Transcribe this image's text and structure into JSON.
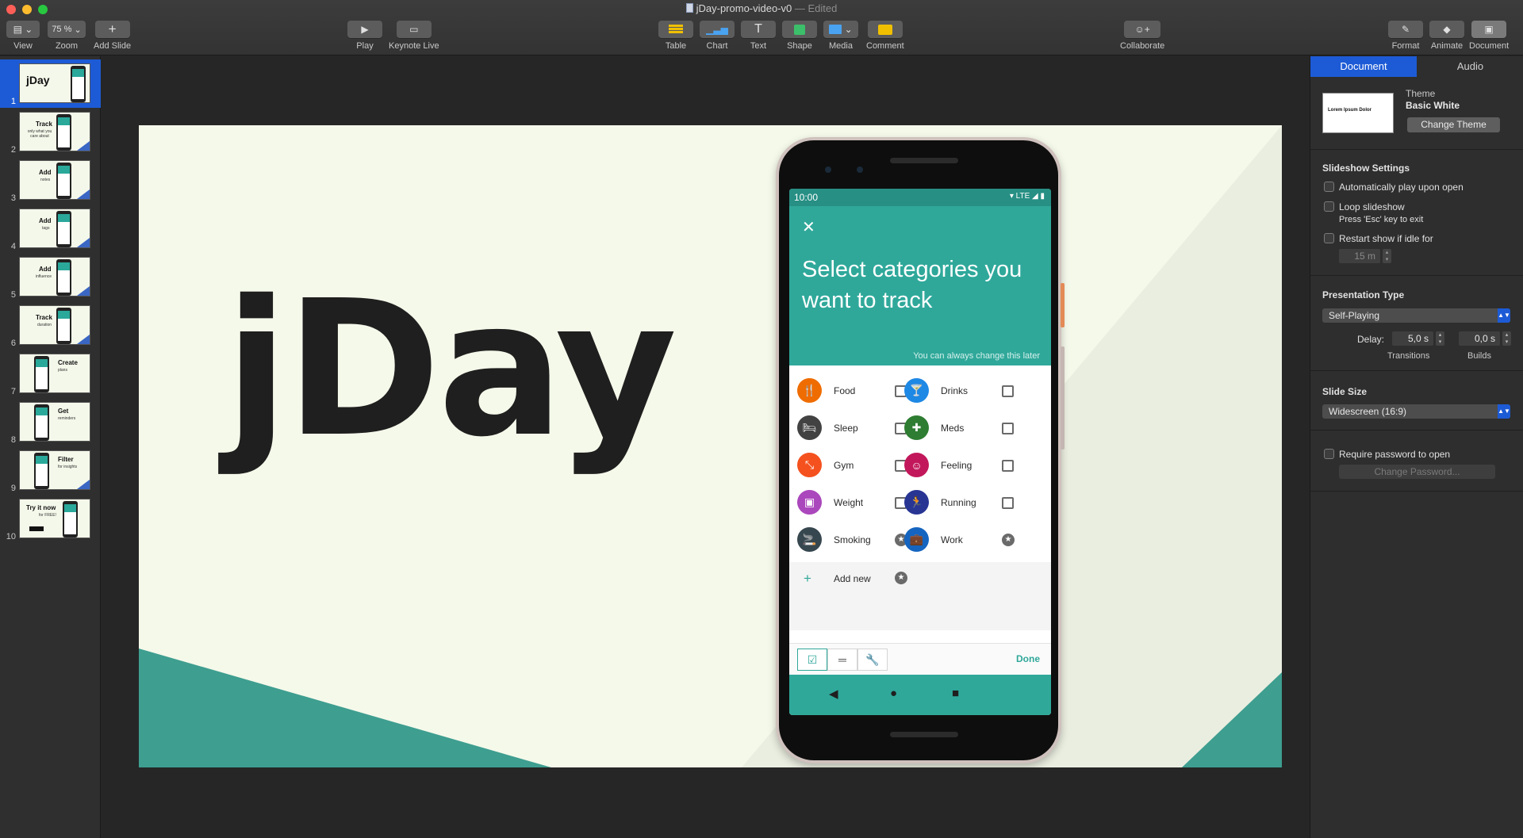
{
  "window": {
    "title": "jDay-promo-video-v0",
    "status": "— Edited"
  },
  "toolbar": {
    "view": "View",
    "zoom": "Zoom",
    "zoom_value": "75 %",
    "add_slide": "Add Slide",
    "play": "Play",
    "keynote_live": "Keynote Live",
    "table": "Table",
    "chart": "Chart",
    "text": "Text",
    "shape": "Shape",
    "media": "Media",
    "comment": "Comment",
    "collaborate": "Collaborate",
    "format": "Format",
    "animate": "Animate",
    "document": "Document"
  },
  "navigator": {
    "slides": [
      {
        "num": "1",
        "title": "jDay",
        "sub": ""
      },
      {
        "num": "2",
        "title": "Track",
        "sub": "only what you care about"
      },
      {
        "num": "3",
        "title": "Add",
        "sub": "notes"
      },
      {
        "num": "4",
        "title": "Add",
        "sub": "tags"
      },
      {
        "num": "5",
        "title": "Add",
        "sub": "influence"
      },
      {
        "num": "6",
        "title": "Track",
        "sub": "duration"
      },
      {
        "num": "7",
        "title": "Create",
        "sub": "plans"
      },
      {
        "num": "8",
        "title": "Get",
        "sub": "reminders"
      },
      {
        "num": "9",
        "title": "Filter",
        "sub": "for insights"
      },
      {
        "num": "10",
        "title": "Try it now",
        "sub": "for FREE!"
      }
    ]
  },
  "slide": {
    "logo": "jDay",
    "phone": {
      "time": "10:00",
      "network": "LTE",
      "heading": "Select categories you want to track",
      "hint": "You can always change this later",
      "categories": [
        {
          "name": "Food",
          "icon": "fork-knife-icon",
          "color": "#ef6c00",
          "glyph": "🍴",
          "marker": "checkbox"
        },
        {
          "name": "Drinks",
          "icon": "cocktail-icon",
          "color": "#1e88e5",
          "glyph": "🍸",
          "marker": "checkbox"
        },
        {
          "name": "Sleep",
          "icon": "bed-icon",
          "color": "#424242",
          "glyph": "🛏",
          "marker": "checkbox"
        },
        {
          "name": "Meds",
          "icon": "medicine-icon",
          "color": "#2e7d32",
          "glyph": "✚",
          "marker": "checkbox"
        },
        {
          "name": "Gym",
          "icon": "fitness-icon",
          "color": "#f4511e",
          "glyph": "⤡",
          "marker": "checkbox"
        },
        {
          "name": "Feeling",
          "icon": "face-icon",
          "color": "#c2185b",
          "glyph": "☺",
          "marker": "checkbox"
        },
        {
          "name": "Weight",
          "icon": "scale-icon",
          "color": "#ab47bc",
          "glyph": "▣",
          "marker": "checkbox"
        },
        {
          "name": "Running",
          "icon": "runner-icon",
          "color": "#283593",
          "glyph": "🏃",
          "marker": "checkbox"
        },
        {
          "name": "Smoking",
          "icon": "cigarette-icon",
          "color": "#37474f",
          "glyph": "🚬",
          "marker": "star"
        },
        {
          "name": "Work",
          "icon": "briefcase-icon",
          "color": "#1565c0",
          "glyph": "💼",
          "marker": "star"
        }
      ],
      "add_new": "Add new",
      "done": "Done"
    }
  },
  "inspector": {
    "tabs": [
      "Document",
      "Audio"
    ],
    "theme_label": "Theme",
    "theme_name": "Basic White",
    "theme_preview_title": "Lorem Ipsum Dolor",
    "change_theme": "Change Theme",
    "slideshow_settings": "Slideshow Settings",
    "auto_play": "Automatically play upon open",
    "loop": "Loop slideshow",
    "loop_hint": "Press 'Esc' key to exit",
    "restart_idle": "Restart show if idle for",
    "idle_value": "15 m",
    "presentation_type": "Presentation Type",
    "presentation_value": "Self-Playing",
    "delay_label": "Delay:",
    "transitions_value": "5,0 s",
    "transitions_label": "Transitions",
    "builds_value": "0,0 s",
    "builds_label": "Builds",
    "slide_size": "Slide Size",
    "slide_size_value": "Widescreen (16:9)",
    "require_password": "Require password to open",
    "change_password": "Change Password..."
  },
  "colors": {
    "accent": "#1d5bd6",
    "app_teal": "#2fa89a",
    "slide_bg": "#f5f9ea"
  }
}
